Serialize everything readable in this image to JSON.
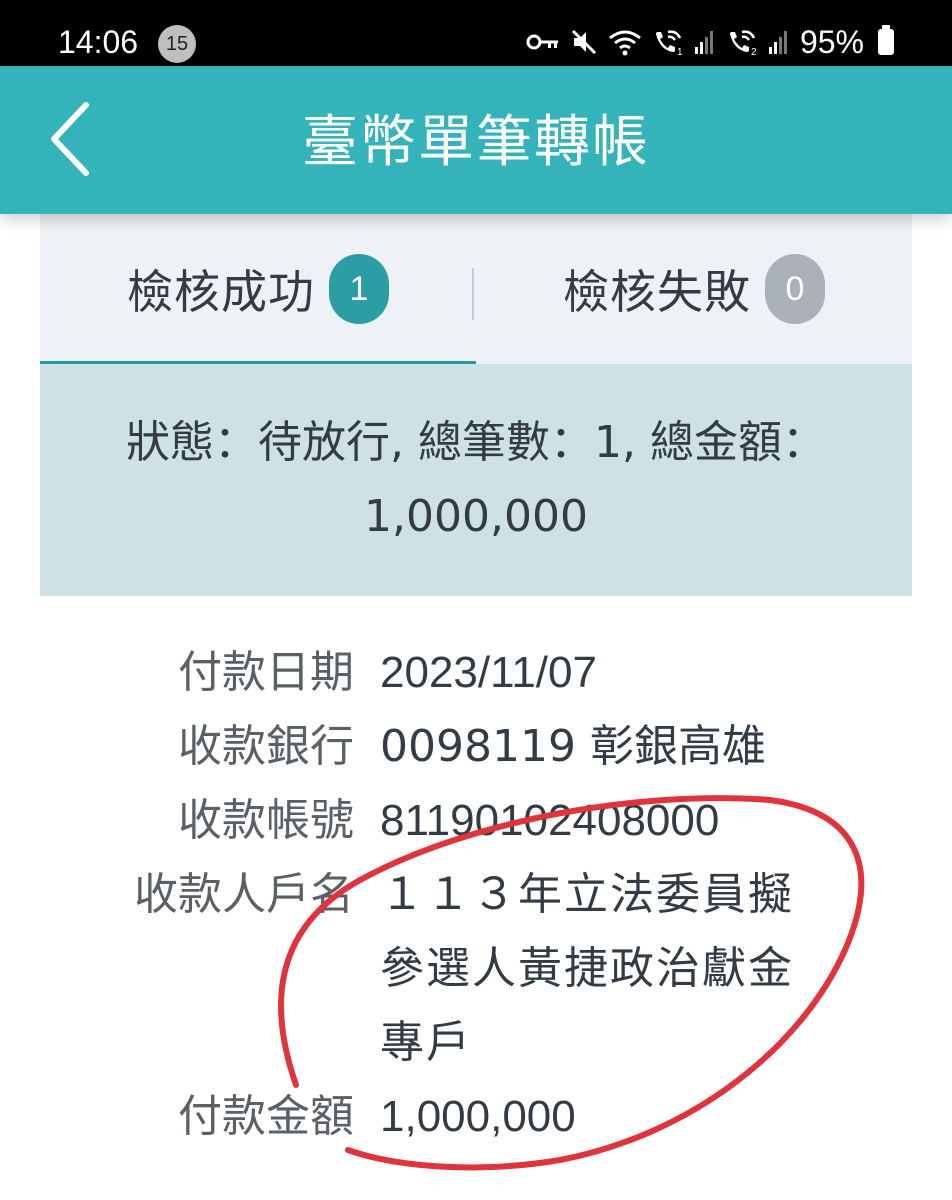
{
  "status_bar": {
    "time": "14:06",
    "notification_count": "15",
    "battery": "95%",
    "icons": [
      "key-icon",
      "mute-icon",
      "wifi-icon",
      "wifi-call-1-icon",
      "signal-1-icon",
      "wifi-call-2-icon",
      "signal-2-icon",
      "battery-icon"
    ]
  },
  "header": {
    "back_icon": "chevron-left-icon",
    "title": "臺幣單筆轉帳"
  },
  "tabs": [
    {
      "label": "檢核成功",
      "count": "1",
      "active": true,
      "badge_color": "#2a9ea3"
    },
    {
      "label": "檢核失敗",
      "count": "0",
      "active": false,
      "badge_color": "#aab2b8"
    }
  ],
  "summary": {
    "text": "狀態：待放行, 總筆數：1, 總金額：1,000,000"
  },
  "details": {
    "payment_date_label": "付款日期",
    "payment_date": "2023/11/07",
    "bank_label": "收款銀行",
    "bank": "0098119 彰銀高雄",
    "account_label": "收款帳號",
    "account": "81190102408000",
    "name_label": "收款人戶名",
    "name": "１１３年立法委員擬參選人黃捷政治獻金專戶",
    "amount_label": "付款金額",
    "amount": "1,000,000"
  },
  "colors": {
    "header": "#35b3bb",
    "accent": "#2a9aa0",
    "summary_bg": "#cde1e7",
    "tab_bg": "#eef1f5",
    "annotation": "#e0343d"
  }
}
